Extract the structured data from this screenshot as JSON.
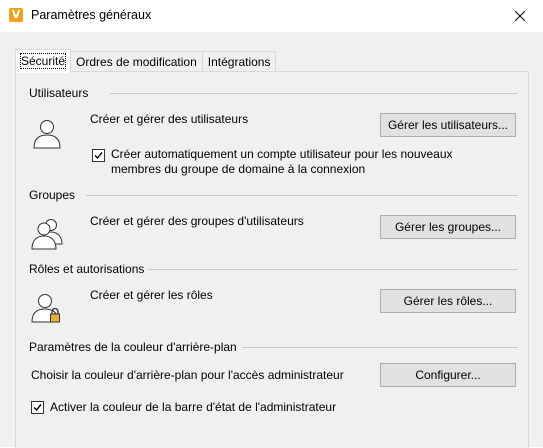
{
  "window": {
    "title": "Paramètres généraux",
    "app_icon_letter": "V",
    "close_icon": "close-icon"
  },
  "tabs": [
    {
      "label": "Sécurité",
      "active": true
    },
    {
      "label": "Ordres de modification",
      "active": false
    },
    {
      "label": "Intégrations",
      "active": false
    }
  ],
  "sections": {
    "users": {
      "title": "Utilisateurs",
      "description": "Créer et gérer des utilisateurs",
      "button": "Gérer les utilisateurs...",
      "checkbox_label_line1": "Créer automatiquement un compte utilisateur pour les nouveaux",
      "checkbox_label_line2": "membres du groupe de domaine à la connexion",
      "checkbox_checked": true,
      "icon": "user-icon"
    },
    "groups": {
      "title": "Groupes",
      "description": "Créer et gérer des groupes d'utilisateurs",
      "button": "Gérer les groupes...",
      "icon": "user-group-icon"
    },
    "roles": {
      "title": "Rôles et autorisations",
      "description": "Créer et gérer les rôles",
      "button": "Gérer les rôles...",
      "icon": "user-lock-icon"
    },
    "background": {
      "title": "Paramètres de la couleur d'arrière-plan",
      "description": "Choisir la couleur d'arrière-plan pour l'accès administrateur",
      "button": "Configurer...",
      "checkbox_label": "Activer la couleur de la barre d'état de l'administrateur",
      "checkbox_checked": true
    }
  },
  "colors": {
    "accent": "#f0a21e",
    "dialog_bg": "#f0f0f0",
    "button_bg": "#e1e1e1"
  }
}
